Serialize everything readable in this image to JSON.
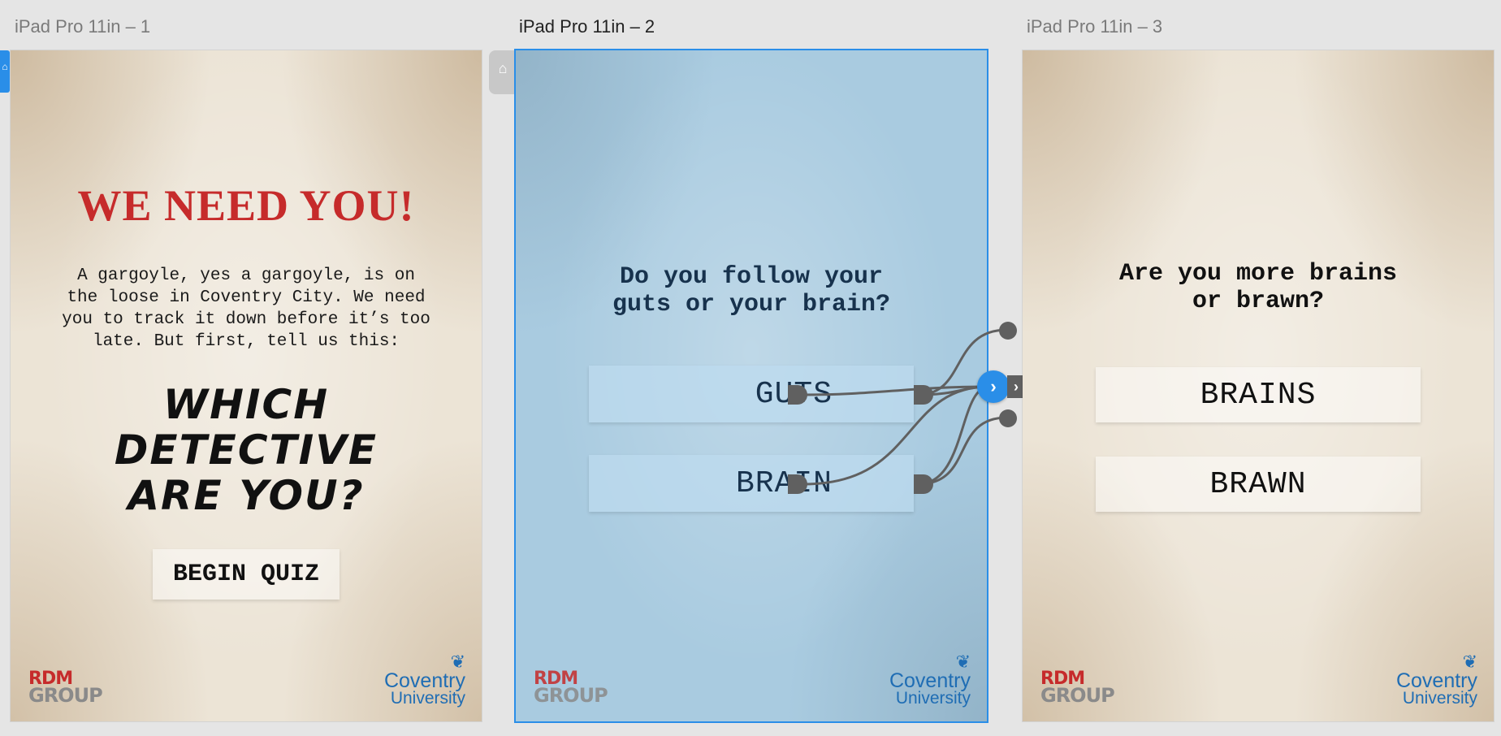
{
  "artboards": [
    {
      "title": "iPad Pro 11in – 1"
    },
    {
      "title": "iPad Pro 11in – 2"
    },
    {
      "title": "iPad Pro 11in – 3"
    }
  ],
  "screen1": {
    "headline": "WE NEED YOU!",
    "intro": "A gargoyle, yes a gargoyle, is on the loose in Coventry City.  We need you to track it down before it’s too late. But first, tell us this:",
    "question_line1": "WHICH",
    "question_line2": "DETECTIVE",
    "question_line3": "ARE YOU?",
    "button": "BEGIN QUIZ"
  },
  "screen2": {
    "question_line1": "Do you follow your",
    "question_line2": "guts or your brain?",
    "option1": "GUTS",
    "option2": "BRAIN"
  },
  "screen3": {
    "question_line1": "Are you more brains",
    "question_line2": "or brawn?",
    "option1": "BRAINS",
    "option2": "BRAWN"
  },
  "logos": {
    "rdm_top": "RDM",
    "rdm_bottom": "GROUP",
    "coventry_top": "Coventry",
    "coventry_bottom": "University"
  },
  "colors": {
    "selection": "#2a8ee8",
    "headline_red": "#c62b2b",
    "wire": "#606060"
  }
}
